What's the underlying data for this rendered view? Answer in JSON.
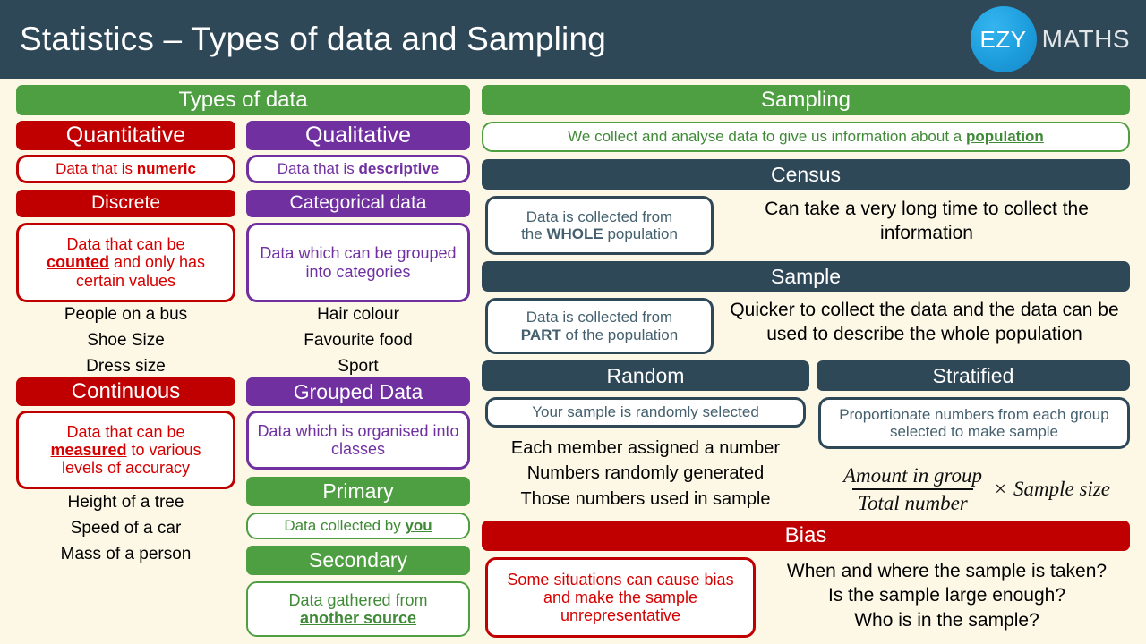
{
  "header": {
    "title": "Statistics – Types of data and Sampling",
    "logo_mark": "EZY",
    "logo_word": "MATHS"
  },
  "colors": {
    "background": "#fdf8e6",
    "header_bg": "#2f4858",
    "green": "#4e9f41",
    "red": "#c00000",
    "purple": "#7030a0",
    "slate": "#2f4858",
    "logo_blue": "#1d9ddc"
  },
  "left_panel": {
    "heading": "Types of data",
    "quantitative": {
      "heading": "Quantitative",
      "definition_prefix": "Data that is ",
      "definition_bold": "numeric",
      "discrete": {
        "heading": "Discrete",
        "definition_line1": "Data that can be",
        "definition_bold": "counted",
        "definition_line2": " and only has",
        "definition_line3": "certain values",
        "examples": [
          "People on a bus",
          "Shoe Size",
          "Dress size"
        ]
      },
      "continuous": {
        "heading": "Continuous",
        "definition_line1": "Data that can be",
        "definition_bold": "measured",
        "definition_line2": " to various",
        "definition_line3": "levels of accuracy",
        "examples": [
          "Height of a tree",
          "Speed of a car",
          "Mass of a person"
        ]
      }
    },
    "qualitative": {
      "heading": "Qualitative",
      "definition_prefix": "Data that is ",
      "definition_bold": "descriptive",
      "categorical": {
        "heading": "Categorical data",
        "definition": "Data which can be grouped into categories",
        "examples": [
          "Hair colour",
          "Favourite food",
          "Sport"
        ]
      },
      "grouped": {
        "heading": "Grouped Data",
        "definition": "Data which is organised into classes"
      }
    },
    "primary": {
      "heading": "Primary",
      "definition_prefix": "Data collected by ",
      "definition_underline": "you"
    },
    "secondary": {
      "heading": "Secondary",
      "definition_prefix": "Data gathered from ",
      "definition_underline": "another source"
    }
  },
  "right_panel": {
    "heading": "Sampling",
    "intro_prefix": "We collect and analyse data to give us information about a ",
    "intro_underline": "population",
    "census": {
      "heading": "Census",
      "note_line1": "Data is collected from",
      "note_line2_prefix": "the ",
      "note_line2_bold": "WHOLE",
      "note_line2_suffix": " population",
      "description": "Can take a very long time to collect the information"
    },
    "sample": {
      "heading": "Sample",
      "note_line1": "Data is collected from",
      "note_line2_bold": "PART",
      "note_line2_suffix": " of the population",
      "description": "Quicker to collect the data and the data can be used to describe the whole population"
    },
    "random": {
      "heading": "Random",
      "note": "Your sample is randomly selected",
      "points": [
        "Each member assigned a number",
        "Numbers randomly generated",
        "Those numbers used in sample"
      ]
    },
    "stratified": {
      "heading": "Stratified",
      "note": "Proportionate numbers from each group selected to make sample",
      "formula": {
        "numerator": "Amount in group",
        "denominator": "Total number",
        "operator": "×",
        "multiplier": "Sample size"
      }
    },
    "bias": {
      "heading": "Bias",
      "note": "Some situations can cause bias and make the sample unrepresentative",
      "questions": [
        "When and where the sample is taken?",
        "Is the sample large enough?",
        "Who is in the sample?"
      ]
    }
  }
}
